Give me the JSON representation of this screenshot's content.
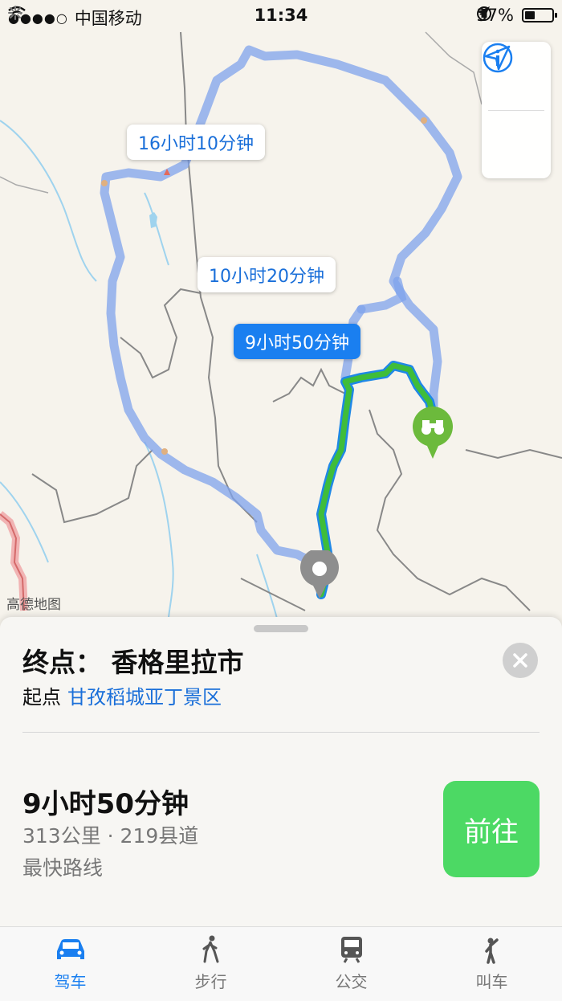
{
  "status_bar": {
    "signal_dots": "●●●●○",
    "carrier": "中国移动",
    "time": "11:34",
    "battery_pct": "37%",
    "battery_level": 0.37
  },
  "map": {
    "watermark": "高德地图",
    "route_labels": [
      {
        "text": "16小时10分钟",
        "style": "white"
      },
      {
        "text": "10小时20分钟",
        "style": "white"
      },
      {
        "text": "9小时50分钟",
        "style": "blue"
      }
    ],
    "colors": {
      "alt_route": "#9db6ee",
      "main_route": "#3fbd3a",
      "accent": "#1a7ff0",
      "poi": "#6cba3c"
    },
    "controls": {
      "info_icon": "info-icon",
      "locate_icon": "location-arrow-icon"
    }
  },
  "sheet": {
    "destination": "终点： 香格里拉市",
    "origin_prefix": "起点",
    "origin": "甘孜稻城亚丁景区",
    "duration": "9小时50分钟",
    "distance": "313公里 · 219县道",
    "note": "最快路线",
    "go_label": "前往"
  },
  "tabs": [
    {
      "label": "驾车",
      "icon": "car-icon",
      "active": true
    },
    {
      "label": "步行",
      "icon": "walking-icon",
      "active": false
    },
    {
      "label": "公交",
      "icon": "train-icon",
      "active": false
    },
    {
      "label": "叫车",
      "icon": "hail-icon",
      "active": false
    }
  ]
}
